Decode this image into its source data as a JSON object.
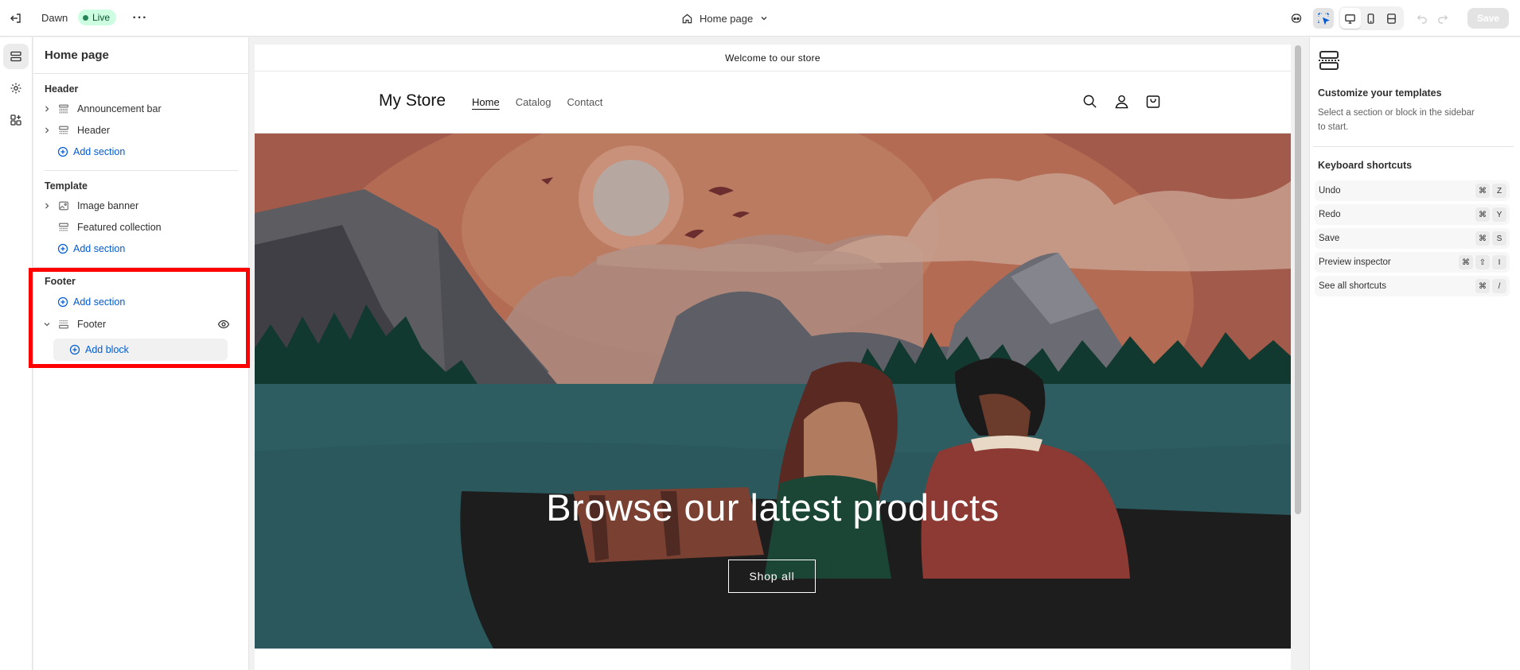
{
  "topbar": {
    "theme_name": "Dawn",
    "status_badge": "Live",
    "page_selector": "Home page",
    "save_label": "Save"
  },
  "sidebar": {
    "title": "Home page",
    "groups": [
      {
        "title": "Header",
        "sections": [
          "Announcement bar",
          "Header"
        ],
        "add_label": "Add section"
      },
      {
        "title": "Template",
        "sections": [
          "Image banner",
          "Featured collection"
        ],
        "add_label": "Add section"
      },
      {
        "title": "Footer",
        "add_label": "Add section",
        "sections": [
          "Footer"
        ],
        "add_block_label": "Add block"
      }
    ]
  },
  "preview": {
    "announcement": "Welcome to our store",
    "store_name": "My Store",
    "nav": [
      "Home",
      "Catalog",
      "Contact"
    ],
    "hero_heading": "Browse our latest products",
    "hero_button": "Shop all"
  },
  "inspector": {
    "title": "Customize your templates",
    "description": "Select a section or block in the sidebar to start.",
    "shortcuts_title": "Keyboard shortcuts",
    "shortcuts": [
      {
        "label": "Undo",
        "keys": [
          "⌘",
          "Z"
        ]
      },
      {
        "label": "Redo",
        "keys": [
          "⌘",
          "Y"
        ]
      },
      {
        "label": "Save",
        "keys": [
          "⌘",
          "S"
        ]
      },
      {
        "label": "Preview inspector",
        "keys": [
          "⌘",
          "⇧",
          "I"
        ]
      },
      {
        "label": "See all shortcuts",
        "keys": [
          "⌘",
          "/"
        ]
      }
    ]
  },
  "colors": {
    "accent_link": "#005bd3",
    "live_badge_bg": "#cdfee1",
    "highlight": "#ff0000"
  }
}
